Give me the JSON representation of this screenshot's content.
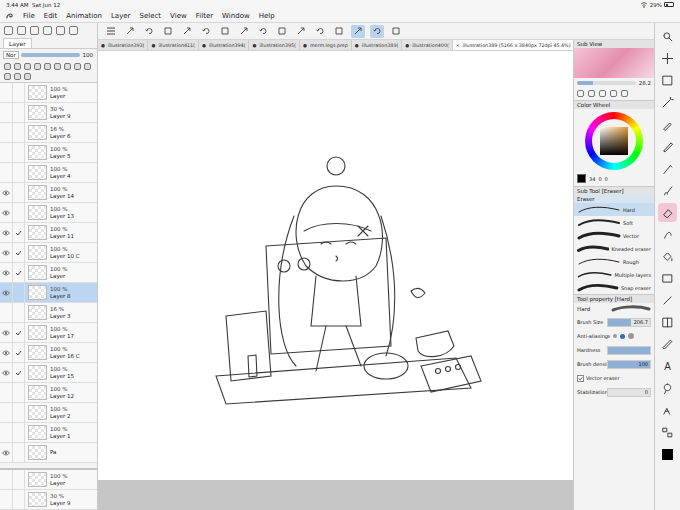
{
  "status": {
    "time": "3:44 AM",
    "date": "Sat Jun 12",
    "battery": "29%"
  },
  "menu": [
    "File",
    "Edit",
    "Animation",
    "Layer",
    "Select",
    "View",
    "Filter",
    "Window",
    "Help"
  ],
  "toolbar": [
    {
      "selected": false
    },
    {
      "selected": false
    },
    {
      "selected": false
    },
    {
      "selected": false
    },
    {
      "selected": false
    },
    {
      "selected": false
    },
    {
      "selected": false
    },
    {
      "selected": false
    },
    {
      "selected": false
    },
    {
      "selected": false
    },
    {
      "selected": false
    },
    {
      "selected": false
    },
    {
      "selected": false
    },
    {
      "selected": true
    },
    {
      "selected": true
    },
    {
      "selected": false
    }
  ],
  "tabs": [
    {
      "label": "illustration393(",
      "mark": "●",
      "selected": false
    },
    {
      "label": "illustration411(",
      "mark": "●",
      "selected": false
    },
    {
      "label": "illustration394(",
      "mark": "●",
      "selected": false
    },
    {
      "label": "illustration395(",
      "mark": "●",
      "selected": false
    },
    {
      "label": "merm.legs.prep",
      "mark": "●",
      "selected": false
    },
    {
      "label": "illustration389(",
      "mark": "●",
      "selected": false
    },
    {
      "label": "illustration400(",
      "mark": "●",
      "selected": false
    },
    {
      "label": "illustration389 (5166 x 3840px 72dpi 45.4%)",
      "mark": "×",
      "selected": true
    }
  ],
  "layer_panel": {
    "tab": "Layer",
    "blend": "Nor",
    "opacity": "100",
    "layers": [
      {
        "opacity": "100 %",
        "name": "Layer",
        "visible": false,
        "checked": false,
        "selected": false
      },
      {
        "opacity": "30 %",
        "name": "Layer 9",
        "visible": false,
        "checked": false,
        "selected": false
      },
      {
        "opacity": "16 %",
        "name": "Layer 6",
        "visible": false,
        "checked": false,
        "selected": false
      },
      {
        "opacity": "100 %",
        "name": "Layer 5",
        "visible": false,
        "checked": false,
        "selected": false
      },
      {
        "opacity": "100 %",
        "name": "Layer 4",
        "visible": false,
        "checked": false,
        "selected": false
      },
      {
        "opacity": "100 %",
        "name": "Layer 14",
        "visible": true,
        "checked": false,
        "selected": false
      },
      {
        "opacity": "100 %",
        "name": "Layer 13",
        "visible": true,
        "checked": false,
        "selected": false
      },
      {
        "opacity": "100 %",
        "name": "Layer 11",
        "visible": true,
        "checked": true,
        "selected": false
      },
      {
        "opacity": "100 %",
        "name": "Layer 10 C",
        "visible": true,
        "checked": true,
        "selected": false
      },
      {
        "opacity": "100 %",
        "name": "Layer",
        "visible": true,
        "checked": true,
        "selected": false
      },
      {
        "opacity": "100 %",
        "name": "Layer 8",
        "visible": true,
        "checked": false,
        "selected": true
      },
      {
        "opacity": "16 %",
        "name": "Layer 3",
        "visible": false,
        "checked": false,
        "selected": false
      },
      {
        "opacity": "100 %",
        "name": "Layer 17",
        "visible": true,
        "checked": true,
        "selected": false
      },
      {
        "opacity": "100 %",
        "name": "Layer 16 C",
        "visible": true,
        "checked": true,
        "selected": false
      },
      {
        "opacity": "100 %",
        "name": "Layer 15",
        "visible": true,
        "checked": true,
        "selected": false
      },
      {
        "opacity": "100 %",
        "name": "Layer 12",
        "visible": false,
        "checked": false,
        "selected": false
      },
      {
        "opacity": "100 %",
        "name": "Layer 2",
        "visible": false,
        "checked": false,
        "selected": false
      },
      {
        "opacity": "100 %",
        "name": "Layer 1",
        "visible": false,
        "checked": false,
        "selected": false
      },
      {
        "opacity": "",
        "name": "Pa",
        "visible": true,
        "checked": false,
        "selected": false
      }
    ],
    "docked": [
      {
        "opacity": "100 %",
        "name": "Layer"
      },
      {
        "opacity": "30 %",
        "name": "Layer 9"
      }
    ]
  },
  "sub_view": {
    "title": "Sub View",
    "zoom": "28.2",
    "level": 0.28
  },
  "color_wheel": {
    "title": "Color Wheel",
    "values": [
      "34",
      "0",
      "0"
    ],
    "color": "#000000"
  },
  "sub_tool": {
    "title": "Sub Tool [Eraser]",
    "group": "Eraser",
    "items": [
      {
        "label": "Hard",
        "selected": true
      },
      {
        "label": "Soft",
        "selected": false
      },
      {
        "label": "Vector",
        "selected": false
      },
      {
        "label": "Kneaded eraser",
        "selected": false
      },
      {
        "label": "Rough",
        "selected": false
      },
      {
        "label": "Multiple layers",
        "selected": false
      },
      {
        "label": "Snap eraser",
        "selected": false
      }
    ]
  },
  "tool_property": {
    "title": "Tool property [Hard]",
    "preset": "Hard",
    "props": [
      {
        "kind": "slider",
        "label": "Brush Size",
        "value": "206.7",
        "level": 0.55
      },
      {
        "kind": "dots",
        "label": "Anti-aliasing",
        "options": [
          {
            "selected": false
          },
          {
            "selected": false
          },
          {
            "selected": true
          },
          {
            "selected": false
          }
        ]
      },
      {
        "kind": "slider",
        "label": "Hardness",
        "value": "",
        "level": 1
      },
      {
        "kind": "slider",
        "label": "Brush density",
        "value": "100",
        "level": 1
      },
      {
        "kind": "check",
        "label": "Vector eraser",
        "checked": true
      },
      {
        "kind": "slider",
        "label": "Stabilization",
        "value": "0",
        "level": 0
      }
    ]
  },
  "tools": [
    {
      "kind": "zoom",
      "selected": false
    },
    {
      "kind": "move",
      "selected": false
    },
    {
      "kind": "select",
      "selected": false
    },
    {
      "kind": "wand",
      "selected": false
    },
    {
      "kind": "eyedropper",
      "selected": false
    },
    {
      "kind": "pen",
      "selected": false
    },
    {
      "kind": "pencil",
      "selected": false
    },
    {
      "kind": "brush",
      "selected": false
    },
    {
      "kind": "eraser",
      "selected": true
    },
    {
      "kind": "blend",
      "selected": false
    },
    {
      "kind": "fill",
      "selected": false
    },
    {
      "kind": "gradient",
      "selected": false
    },
    {
      "kind": "figure",
      "selected": false
    },
    {
      "kind": "frame",
      "selected": false
    },
    {
      "kind": "ruler",
      "selected": false
    },
    {
      "kind": "text",
      "selected": false,
      "label": "A"
    },
    {
      "kind": "balloon",
      "selected": false
    },
    {
      "kind": "correct",
      "selected": false
    },
    {
      "kind": "swatch",
      "selected": false
    }
  ]
}
